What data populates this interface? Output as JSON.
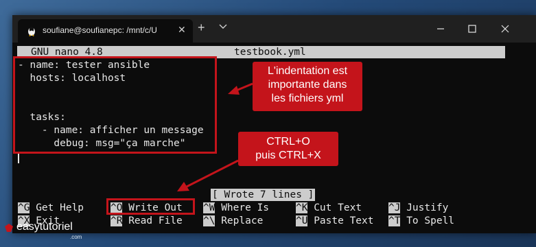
{
  "window": {
    "tab_title": "soufiane@soufianepc: /mnt/c/U",
    "tab_close": "✕",
    "new_tab": "+"
  },
  "nano": {
    "header_left": "GNU nano 4.8",
    "header_file": "testbook.yml",
    "lines": [
      "- name: tester ansible",
      "  hosts: localhost",
      "",
      "",
      "  tasks:",
      "    - name: afficher un message",
      "      debug: msg=\"ça marche\""
    ],
    "status": "[ Wrote 7 lines ]",
    "shortcuts": [
      {
        "key": "^G",
        "label": "Get Help"
      },
      {
        "key": "^O",
        "label": "Write Out"
      },
      {
        "key": "^W",
        "label": "Where Is"
      },
      {
        "key": "^K",
        "label": "Cut Text"
      },
      {
        "key": "^J",
        "label": "Justify"
      },
      {
        "key": "^X",
        "label": "Exit"
      },
      {
        "key": "^R",
        "label": "Read File"
      },
      {
        "key": "^\\",
        "label": "Replace"
      },
      {
        "key": "^U",
        "label": "Paste Text"
      },
      {
        "key": "^T",
        "label": "To Spell"
      }
    ]
  },
  "annotations": {
    "callout1": [
      "L'indentation est",
      "importante dans",
      "les fichiers yml"
    ],
    "callout2": [
      "CTRL+O",
      "puis CTRL+X"
    ]
  },
  "watermark": {
    "text": "easytutoriel",
    "sub": ".com"
  },
  "colors": {
    "accent_red": "#c4141b",
    "terminal_bg": "#0c0c0c",
    "nano_bar": "#cccccc"
  }
}
